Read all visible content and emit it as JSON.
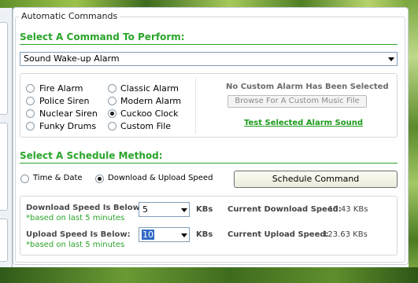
{
  "group_title": "Automatic Commands",
  "command_section": {
    "title": "Select A Command To Perform:",
    "selected_command": "Sound Wake-up Alarm"
  },
  "alarms": {
    "col1": [
      "Fire Alarm",
      "Police Siren",
      "Nuclear Siren",
      "Funky Drums"
    ],
    "col2": [
      "Classic Alarm",
      "Modern Alarm",
      "Cuckoo Clock",
      "Custom File"
    ],
    "selected": "Cuckoo Clock",
    "no_custom_note": "No Custom Alarm Has Been Selected",
    "browse_label": "Browse For A Custom Music File",
    "test_link": "Test Selected Alarm Sound"
  },
  "schedule_section": {
    "title": "Select A Schedule Method:",
    "option_time": "Time & Date",
    "option_speed": "Download & Upload Speed",
    "selected": "Download & Upload Speed",
    "schedule_button": "Schedule Command"
  },
  "speed": {
    "download_label": "Download Speed Is Below:",
    "download_value": "5",
    "download_hint": "*based on last 5 minutes",
    "upload_label": "Upload Speed Is Below:",
    "upload_value": "10",
    "upload_hint": "*based on last 5 minutes",
    "unit": "KBs",
    "current_download_label": "Current Download Speed:",
    "current_download_value": "15.43 KBs",
    "current_upload_label": "Current Upload Speed:",
    "current_upload_value": "123.63 KBs"
  }
}
